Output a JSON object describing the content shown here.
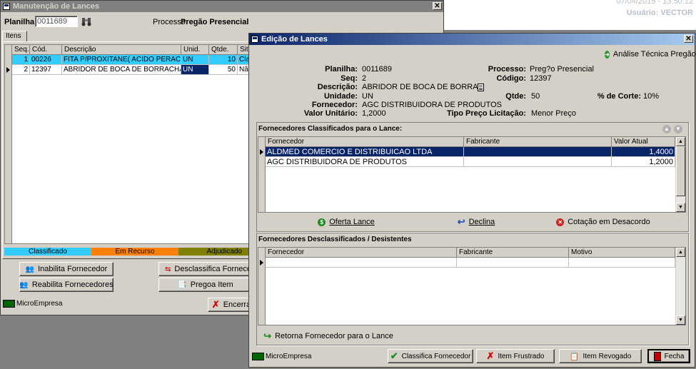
{
  "top_right": {
    "datetime": "07/04/2015 - 13:50:12",
    "user": "Usuário: VECTOR"
  },
  "main_window": {
    "title": "Manutenção de Lances",
    "planilha_label": "Planilha:",
    "planilha_value": "0011689",
    "processo_label": "Processo:",
    "processo_value": "Pregão Presencial",
    "tab_label": "Itens",
    "columns": [
      "Seq.",
      "Cód.",
      "Descrição",
      "Unid.",
      "Qtde.",
      "Situ"
    ],
    "rows": [
      {
        "seq": "1",
        "cod": "00226",
        "desc": "FITA P/PROXITANE( ACIDO PERACETICO",
        "unid": "UN",
        "qtde": "10",
        "situ": "Clas"
      },
      {
        "seq": "2",
        "cod": "12397",
        "desc": "ABRIDOR DE BOCA DE BORRACHA ADUL",
        "unid": "UN",
        "qtde": "50",
        "situ": "Não"
      }
    ],
    "legend": [
      "Classificado",
      "Em Recurso",
      "Adjudicado"
    ],
    "buttons": {
      "inabilita": "Inabilita Fornecedor",
      "desclassifica": "Desclassifica Fornecedor pa",
      "reabilita": "Reabilita Fornecedores",
      "pregoa": "Pregoa Item",
      "encerra": "Encerra"
    },
    "micro_label": "MicroEmpresa"
  },
  "dialog": {
    "title": "Edição de Lances",
    "analise_button": "Análise Técnica Pregão",
    "info": {
      "planilha_label": "Planilha:",
      "planilha_value": "0011689",
      "seq_label": "Seq:",
      "seq_value": "2",
      "descricao_label": "Descrição:",
      "descricao_value": "ABRIDOR DE BOCA DE BORRAC",
      "unidade_label": "Unidade:",
      "unidade_value": "UN",
      "fornecedor_label": "Fornecedor:",
      "fornecedor_value": "AGC DISTRIBUIDORA DE PRODUTOS",
      "valor_label": "Valor Unitário:",
      "valor_value": "1,2000",
      "processo_label": "Processo:",
      "processo_value": "Preg?o Presencial",
      "codigo_label": "Código:",
      "codigo_value": "12397",
      "qtde_label": "Qtde:",
      "qtde_value": "50",
      "corte_label": "% de Corte:",
      "corte_value": "10%",
      "tipo_label": "Tipo Preço Licitação:",
      "tipo_value": "Menor Preço"
    },
    "classificados": {
      "title": "Fornecedores Classificados para o Lance:",
      "columns": [
        "Fornecedor",
        "Fabricante",
        "Valor Atual"
      ],
      "rows": [
        {
          "fornecedor": "ALDMED COMERCIO E DISTRIBUICAO LTDA",
          "fabricante": "",
          "valor": "1,4000"
        },
        {
          "fornecedor": "AGC DISTRIBUIDORA DE PRODUTOS",
          "fabricante": "",
          "valor": "1,2000"
        }
      ]
    },
    "actions": {
      "oferta": "Oferta Lance",
      "declina": "Declina",
      "cotacao": "Cotação em Desacordo"
    },
    "desclassificados": {
      "title": "Fornecedores Desclassificados / Desistentes",
      "columns": [
        "Fornecedor",
        "Fabricante",
        "Motivo"
      ]
    },
    "retorna": "Retorna Fornecedor para o Lance",
    "micro_label": "MicroEmpresa",
    "bottom_buttons": {
      "classifica": "Classifica Fornecedor",
      "frustrado": "Item Frustrado",
      "revogado": "Item Revogado",
      "fecha": "Fecha"
    }
  },
  "colors": {
    "classificado": "#33ccff",
    "em_recurso": "#ff8000",
    "adjudicado": "#808000",
    "selected_row": "#0a246a",
    "micro": "#006400"
  }
}
